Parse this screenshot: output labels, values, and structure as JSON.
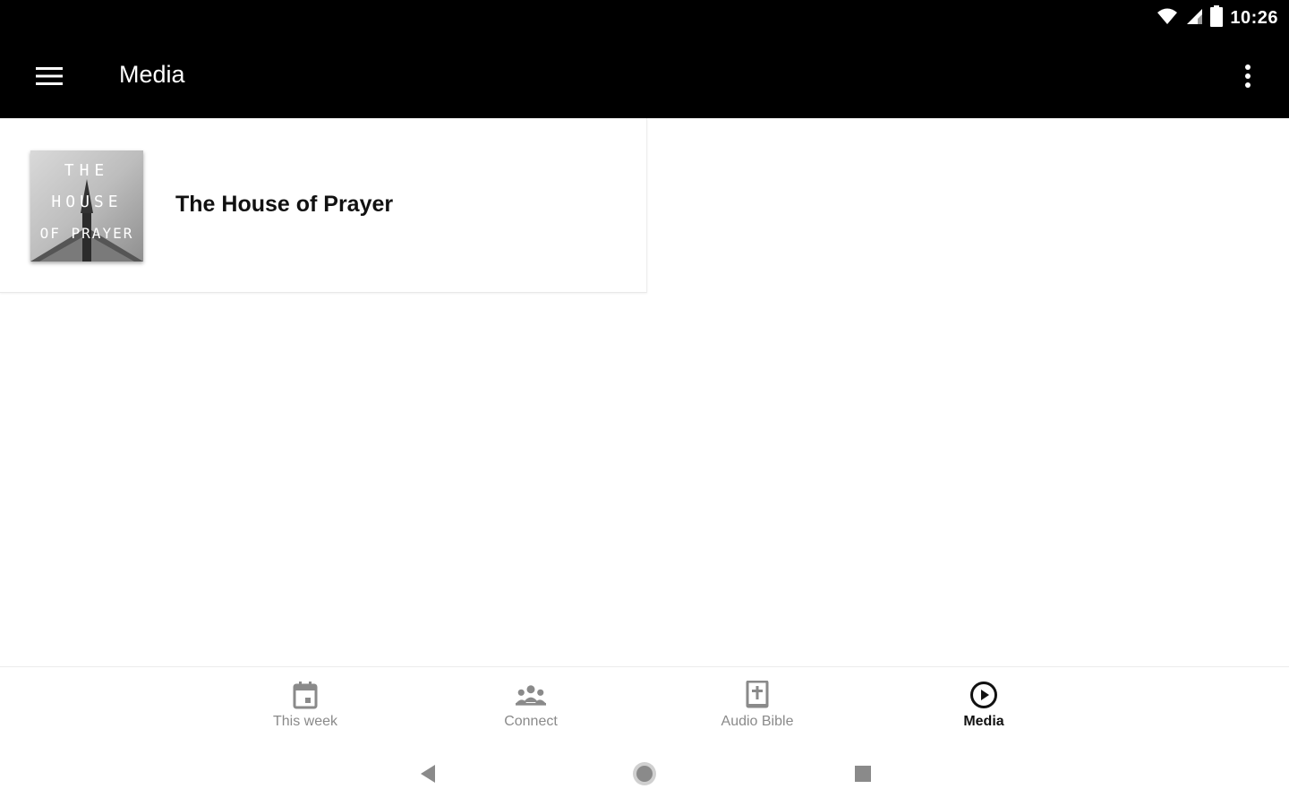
{
  "status_bar": {
    "time": "10:26",
    "icons": [
      "wifi-icon",
      "signal-icon",
      "battery-icon"
    ]
  },
  "app_bar": {
    "title": "Media",
    "menu_icon": "hamburger-menu-icon",
    "overflow_icon": "more-vert-icon"
  },
  "media_items": [
    {
      "title": "The House of Prayer",
      "thumbnail_icon": "house-of-prayer-artwork",
      "thumbnail_text": [
        "THE",
        "HOUSE",
        "OF PRAYER"
      ]
    }
  ],
  "bottom_nav": {
    "items": [
      {
        "label": "This week",
        "icon": "calendar-icon",
        "active": false
      },
      {
        "label": "Connect",
        "icon": "people-icon",
        "active": false
      },
      {
        "label": "Audio Bible",
        "icon": "bible-icon",
        "active": false
      },
      {
        "label": "Media",
        "icon": "play-circle-icon",
        "active": true
      }
    ]
  },
  "system_nav": {
    "icons": [
      "back-icon",
      "home-icon",
      "recents-icon"
    ]
  },
  "colors": {
    "app_bar": "#000000",
    "background": "#ffffff",
    "nav_inactive": "#8a8a8a",
    "nav_active": "#111111"
  }
}
